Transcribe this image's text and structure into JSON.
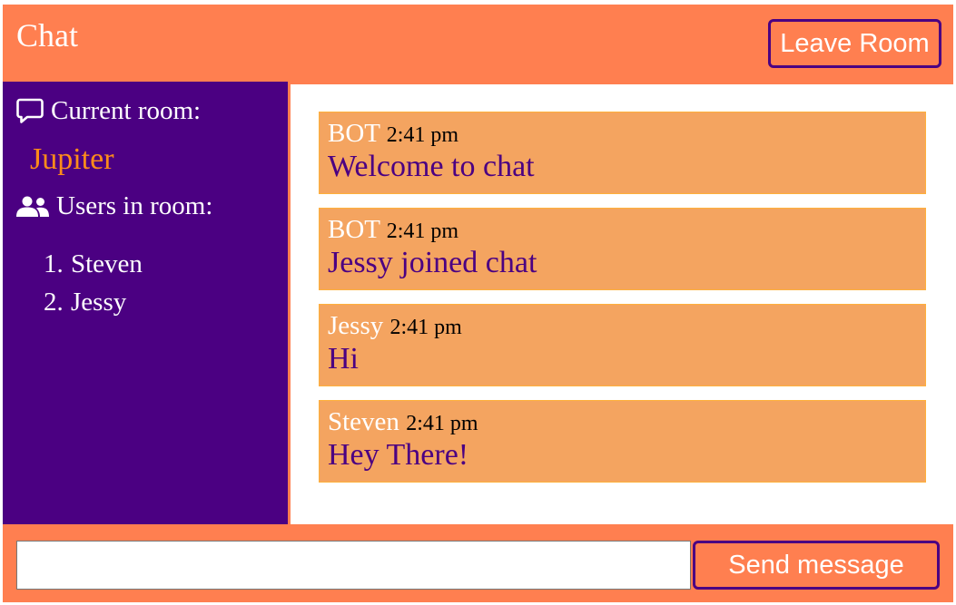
{
  "header": {
    "title": "Chat",
    "leave_label": "Leave Room"
  },
  "sidebar": {
    "room_heading": "Current room:",
    "room_name": "Jupiter",
    "users_heading": "Users in room:",
    "users": [
      {
        "num": "1.",
        "name": "Steven"
      },
      {
        "num": "2.",
        "name": "Jessy"
      }
    ],
    "icons": {
      "room": "chat-bubble-icon",
      "users": "users-icon"
    }
  },
  "messages": [
    {
      "author": "BOT",
      "time": "2:41 pm",
      "text": "Welcome to chat"
    },
    {
      "author": "BOT",
      "time": "2:41 pm",
      "text": "Jessy joined chat"
    },
    {
      "author": "Jessy",
      "time": "2:41 pm",
      "text": "Hi"
    },
    {
      "author": "Steven",
      "time": "2:41 pm",
      "text": "Hey There!"
    }
  ],
  "composer": {
    "value": "",
    "placeholder": "",
    "send_label": "Send message"
  },
  "colors": {
    "primary": "#ff7f50",
    "sidebar": "#4b0082",
    "message_bg": "#f4a460",
    "room_name": "#ff8c1a",
    "message_text": "#4b0082"
  }
}
